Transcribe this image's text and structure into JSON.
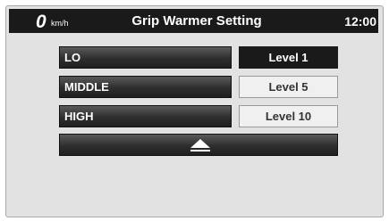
{
  "header": {
    "speed_value": "0",
    "speed_unit": "km/h",
    "title": "Grip Warmer Setting",
    "clock": "12:00"
  },
  "options": [
    {
      "label": "LO",
      "level": "Level 1",
      "selected": true
    },
    {
      "label": "MIDDLE",
      "level": "Level 5",
      "selected": false
    },
    {
      "label": "HIGH",
      "level": "Level 10",
      "selected": false
    }
  ],
  "scroll": {
    "icon": "up-arrow-icon"
  },
  "colors": {
    "header_bg": "#1a1a1a",
    "panel_bg": "#e2e2e2",
    "button_dark": "#2e2e2e",
    "level_selected_bg": "#1a1a1a",
    "level_unselected_bg": "#f0f0f0"
  }
}
